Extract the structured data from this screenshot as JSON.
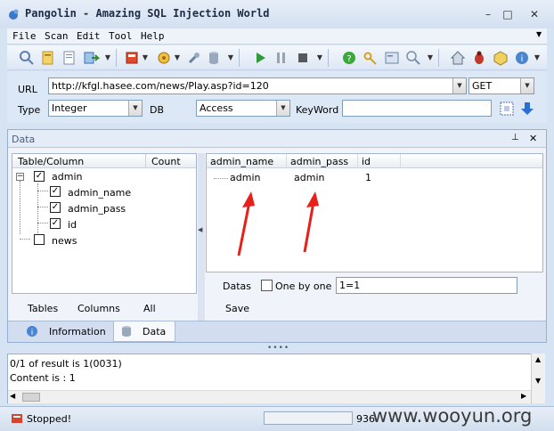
{
  "window": {
    "title": "Pangolin - Amazing SQL Injection World",
    "minimize": "–",
    "maximize": "□",
    "close": "✕"
  },
  "menu": [
    "File",
    "Scan",
    "Edit",
    "Tool",
    "Help"
  ],
  "toolbar": {
    "icons": [
      "search-icon",
      "document-icon",
      "page-icon",
      "export-icon",
      "flag-icon",
      "tools-icon",
      "wrench-icon",
      "database-icon",
      "play-icon",
      "pause-icon",
      "stop-icon",
      "help-icon",
      "key-icon",
      "settings-icon",
      "magnifier-icon",
      "home-icon",
      "bug-icon",
      "package-icon",
      "info-icon"
    ]
  },
  "url_panel": {
    "url_label": "URL",
    "url_value": "http://kfgl.hasee.com/news/Play.asp?id=120",
    "method": "GET",
    "type_label": "Type",
    "type_value": "Integer",
    "db_label": "DB",
    "db_value": "Access",
    "keyword_label": "KeyWord",
    "keyword_value": ""
  },
  "data_panel": {
    "title": "Data",
    "pin": "⊥",
    "close": "✕",
    "tree": {
      "col_table": "Table/Column",
      "col_count": "Count",
      "admin_table": "admin",
      "expander": "−",
      "columns": [
        "admin_name",
        "admin_pass",
        "id"
      ],
      "news_table": "news"
    },
    "grid": {
      "headers": [
        "admin_name",
        "admin_pass",
        "id"
      ],
      "row": [
        "admin",
        "admin",
        "1"
      ]
    },
    "tree_buttons": [
      "Tables",
      "Columns",
      "All"
    ],
    "datas_label": "Datas",
    "one_by_one": "One by one",
    "condition": "1=1",
    "save": "Save"
  },
  "tabs": [
    "Information",
    "Data"
  ],
  "output": {
    "lines": [
      "0/1 of result is 1(0031)",
      "Content is : 1"
    ]
  },
  "status": {
    "text": "Stopped!",
    "count": "936"
  },
  "watermark": "www.wooyun.org",
  "colors": {
    "arrow": "#e8201a",
    "accent": "#2a6fd1"
  }
}
